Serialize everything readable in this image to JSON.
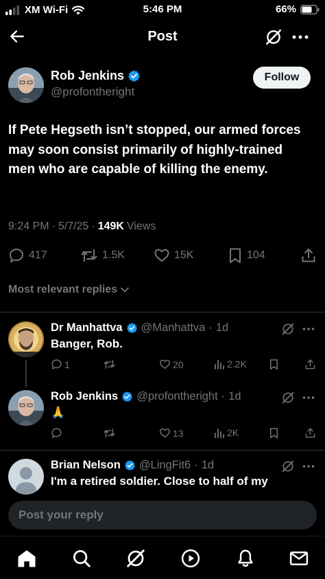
{
  "status_bar": {
    "carrier": "XM Wi-Fi",
    "time": "5:46 PM",
    "battery": "66%"
  },
  "header": {
    "title": "Post",
    "back_icon": "arrow-left-icon",
    "grok_icon": "grok-icon",
    "more_icon": "more-horizontal-icon"
  },
  "post": {
    "author_name": "Rob Jenkins",
    "author_handle": "@profontheright",
    "follow_label": "Follow",
    "text": "If Pete Hegseth isn’t stopped, our armed forces may soon consist primarily of highly-trained men who are capable of killing the enemy.",
    "time": "9:24 PM",
    "date": "5/7/25",
    "views_count": "149K",
    "views_label": "Views",
    "replies": "417",
    "reposts": "1.5K",
    "likes": "15K",
    "bookmarks": "104",
    "relevant_label": "Most relevant replies"
  },
  "replies": [
    {
      "name": "Dr Manhattva",
      "handle": "@Manhattva",
      "age": "1d",
      "text": "Banger, Rob.",
      "replies": "1",
      "reposts": "",
      "likes": "20",
      "views": "2.2K"
    },
    {
      "name": "Rob Jenkins",
      "handle": "@profontheright",
      "age": "1d",
      "text": "🙏",
      "replies": "",
      "reposts": "",
      "likes": "13",
      "views": "2K"
    },
    {
      "name": "Brian Nelson",
      "handle": "@LingFit6",
      "age": "1d",
      "text": "I'm a retired soldier. Close to half of my"
    }
  ],
  "composer": {
    "placeholder": "Post your reply"
  },
  "colors": {
    "background": "#000000",
    "verified": "#1d9bf0",
    "muted": "#71767b",
    "text": "#e7e9ea"
  }
}
